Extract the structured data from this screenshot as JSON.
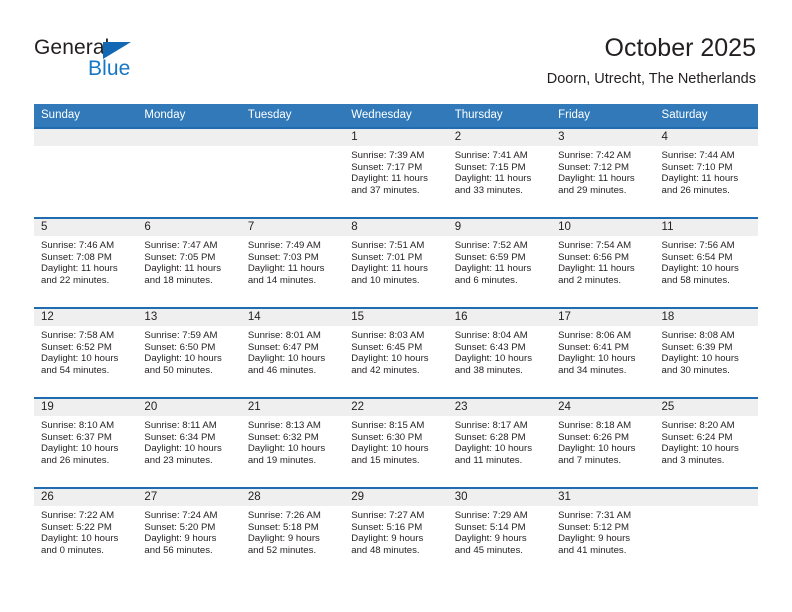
{
  "brand": {
    "name_part1": "General",
    "name_part2": "Blue",
    "triangle_icon": "triangle-icon",
    "accent_color": "#1777c4",
    "logo_dark": "#231f20"
  },
  "header": {
    "title": "October 2025",
    "subtitle": "Doorn, Utrecht, The Netherlands"
  },
  "theme": {
    "header_blue": "#3179b8",
    "week_border_blue": "#1f6cb0",
    "daynum_band": "#efefef",
    "text": "#231f20"
  },
  "weekday_headers": [
    "Sunday",
    "Monday",
    "Tuesday",
    "Wednesday",
    "Thursday",
    "Friday",
    "Saturday"
  ],
  "labels": {
    "sunrise": "Sunrise:",
    "sunset": "Sunset:",
    "daylight": "Daylight:"
  },
  "weeks": [
    [
      {
        "day": "",
        "sunrise": "",
        "sunset": "",
        "daylight_line1": "",
        "daylight_line2": ""
      },
      {
        "day": "",
        "sunrise": "",
        "sunset": "",
        "daylight_line1": "",
        "daylight_line2": ""
      },
      {
        "day": "",
        "sunrise": "",
        "sunset": "",
        "daylight_line1": "",
        "daylight_line2": ""
      },
      {
        "day": "1",
        "sunrise": "Sunrise: 7:39 AM",
        "sunset": "Sunset: 7:17 PM",
        "daylight_line1": "Daylight: 11 hours",
        "daylight_line2": "and 37 minutes."
      },
      {
        "day": "2",
        "sunrise": "Sunrise: 7:41 AM",
        "sunset": "Sunset: 7:15 PM",
        "daylight_line1": "Daylight: 11 hours",
        "daylight_line2": "and 33 minutes."
      },
      {
        "day": "3",
        "sunrise": "Sunrise: 7:42 AM",
        "sunset": "Sunset: 7:12 PM",
        "daylight_line1": "Daylight: 11 hours",
        "daylight_line2": "and 29 minutes."
      },
      {
        "day": "4",
        "sunrise": "Sunrise: 7:44 AM",
        "sunset": "Sunset: 7:10 PM",
        "daylight_line1": "Daylight: 11 hours",
        "daylight_line2": "and 26 minutes."
      }
    ],
    [
      {
        "day": "5",
        "sunrise": "Sunrise: 7:46 AM",
        "sunset": "Sunset: 7:08 PM",
        "daylight_line1": "Daylight: 11 hours",
        "daylight_line2": "and 22 minutes."
      },
      {
        "day": "6",
        "sunrise": "Sunrise: 7:47 AM",
        "sunset": "Sunset: 7:05 PM",
        "daylight_line1": "Daylight: 11 hours",
        "daylight_line2": "and 18 minutes."
      },
      {
        "day": "7",
        "sunrise": "Sunrise: 7:49 AM",
        "sunset": "Sunset: 7:03 PM",
        "daylight_line1": "Daylight: 11 hours",
        "daylight_line2": "and 14 minutes."
      },
      {
        "day": "8",
        "sunrise": "Sunrise: 7:51 AM",
        "sunset": "Sunset: 7:01 PM",
        "daylight_line1": "Daylight: 11 hours",
        "daylight_line2": "and 10 minutes."
      },
      {
        "day": "9",
        "sunrise": "Sunrise: 7:52 AM",
        "sunset": "Sunset: 6:59 PM",
        "daylight_line1": "Daylight: 11 hours",
        "daylight_line2": "and 6 minutes."
      },
      {
        "day": "10",
        "sunrise": "Sunrise: 7:54 AM",
        "sunset": "Sunset: 6:56 PM",
        "daylight_line1": "Daylight: 11 hours",
        "daylight_line2": "and 2 minutes."
      },
      {
        "day": "11",
        "sunrise": "Sunrise: 7:56 AM",
        "sunset": "Sunset: 6:54 PM",
        "daylight_line1": "Daylight: 10 hours",
        "daylight_line2": "and 58 minutes."
      }
    ],
    [
      {
        "day": "12",
        "sunrise": "Sunrise: 7:58 AM",
        "sunset": "Sunset: 6:52 PM",
        "daylight_line1": "Daylight: 10 hours",
        "daylight_line2": "and 54 minutes."
      },
      {
        "day": "13",
        "sunrise": "Sunrise: 7:59 AM",
        "sunset": "Sunset: 6:50 PM",
        "daylight_line1": "Daylight: 10 hours",
        "daylight_line2": "and 50 minutes."
      },
      {
        "day": "14",
        "sunrise": "Sunrise: 8:01 AM",
        "sunset": "Sunset: 6:47 PM",
        "daylight_line1": "Daylight: 10 hours",
        "daylight_line2": "and 46 minutes."
      },
      {
        "day": "15",
        "sunrise": "Sunrise: 8:03 AM",
        "sunset": "Sunset: 6:45 PM",
        "daylight_line1": "Daylight: 10 hours",
        "daylight_line2": "and 42 minutes."
      },
      {
        "day": "16",
        "sunrise": "Sunrise: 8:04 AM",
        "sunset": "Sunset: 6:43 PM",
        "daylight_line1": "Daylight: 10 hours",
        "daylight_line2": "and 38 minutes."
      },
      {
        "day": "17",
        "sunrise": "Sunrise: 8:06 AM",
        "sunset": "Sunset: 6:41 PM",
        "daylight_line1": "Daylight: 10 hours",
        "daylight_line2": "and 34 minutes."
      },
      {
        "day": "18",
        "sunrise": "Sunrise: 8:08 AM",
        "sunset": "Sunset: 6:39 PM",
        "daylight_line1": "Daylight: 10 hours",
        "daylight_line2": "and 30 minutes."
      }
    ],
    [
      {
        "day": "19",
        "sunrise": "Sunrise: 8:10 AM",
        "sunset": "Sunset: 6:37 PM",
        "daylight_line1": "Daylight: 10 hours",
        "daylight_line2": "and 26 minutes."
      },
      {
        "day": "20",
        "sunrise": "Sunrise: 8:11 AM",
        "sunset": "Sunset: 6:34 PM",
        "daylight_line1": "Daylight: 10 hours",
        "daylight_line2": "and 23 minutes."
      },
      {
        "day": "21",
        "sunrise": "Sunrise: 8:13 AM",
        "sunset": "Sunset: 6:32 PM",
        "daylight_line1": "Daylight: 10 hours",
        "daylight_line2": "and 19 minutes."
      },
      {
        "day": "22",
        "sunrise": "Sunrise: 8:15 AM",
        "sunset": "Sunset: 6:30 PM",
        "daylight_line1": "Daylight: 10 hours",
        "daylight_line2": "and 15 minutes."
      },
      {
        "day": "23",
        "sunrise": "Sunrise: 8:17 AM",
        "sunset": "Sunset: 6:28 PM",
        "daylight_line1": "Daylight: 10 hours",
        "daylight_line2": "and 11 minutes."
      },
      {
        "day": "24",
        "sunrise": "Sunrise: 8:18 AM",
        "sunset": "Sunset: 6:26 PM",
        "daylight_line1": "Daylight: 10 hours",
        "daylight_line2": "and 7 minutes."
      },
      {
        "day": "25",
        "sunrise": "Sunrise: 8:20 AM",
        "sunset": "Sunset: 6:24 PM",
        "daylight_line1": "Daylight: 10 hours",
        "daylight_line2": "and 3 minutes."
      }
    ],
    [
      {
        "day": "26",
        "sunrise": "Sunrise: 7:22 AM",
        "sunset": "Sunset: 5:22 PM",
        "daylight_line1": "Daylight: 10 hours",
        "daylight_line2": "and 0 minutes."
      },
      {
        "day": "27",
        "sunrise": "Sunrise: 7:24 AM",
        "sunset": "Sunset: 5:20 PM",
        "daylight_line1": "Daylight: 9 hours",
        "daylight_line2": "and 56 minutes."
      },
      {
        "day": "28",
        "sunrise": "Sunrise: 7:26 AM",
        "sunset": "Sunset: 5:18 PM",
        "daylight_line1": "Daylight: 9 hours",
        "daylight_line2": "and 52 minutes."
      },
      {
        "day": "29",
        "sunrise": "Sunrise: 7:27 AM",
        "sunset": "Sunset: 5:16 PM",
        "daylight_line1": "Daylight: 9 hours",
        "daylight_line2": "and 48 minutes."
      },
      {
        "day": "30",
        "sunrise": "Sunrise: 7:29 AM",
        "sunset": "Sunset: 5:14 PM",
        "daylight_line1": "Daylight: 9 hours",
        "daylight_line2": "and 45 minutes."
      },
      {
        "day": "31",
        "sunrise": "Sunrise: 7:31 AM",
        "sunset": "Sunset: 5:12 PM",
        "daylight_line1": "Daylight: 9 hours",
        "daylight_line2": "and 41 minutes."
      },
      {
        "day": "",
        "sunrise": "",
        "sunset": "",
        "daylight_line1": "",
        "daylight_line2": ""
      }
    ]
  ]
}
